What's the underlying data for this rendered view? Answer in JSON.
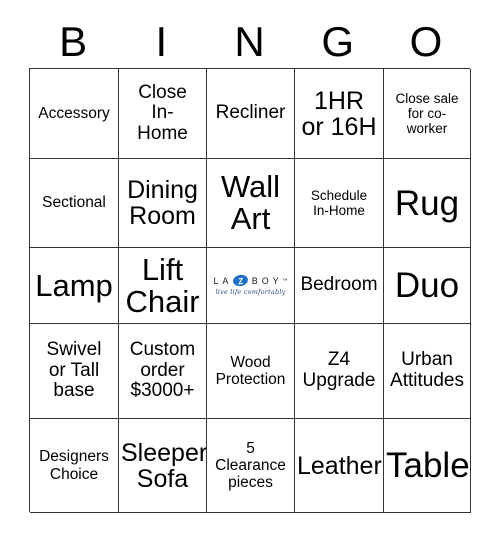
{
  "header": {
    "letters": [
      "B",
      "I",
      "N",
      "G",
      "O"
    ]
  },
  "grid": {
    "rows": [
      [
        {
          "label": "Accessory",
          "size": "sm"
        },
        {
          "label": "Close\nIn-\nHome",
          "size": "md"
        },
        {
          "label": "Recliner",
          "size": "md"
        },
        {
          "label": "1HR\nor 16H",
          "size": "lg"
        },
        {
          "label": "Close sale\nfor co-\nworker",
          "size": "xs"
        }
      ],
      [
        {
          "label": "Sectional",
          "size": "sm"
        },
        {
          "label": "Dining\nRoom",
          "size": "lg"
        },
        {
          "label": "Wall\nArt",
          "size": "xl"
        },
        {
          "label": "Schedule\nIn-Home",
          "size": "xs"
        },
        {
          "label": "Rug",
          "size": "xxl"
        }
      ],
      [
        {
          "label": "Lamp",
          "size": "xl"
        },
        {
          "label": "Lift\nChair",
          "size": "xl"
        },
        {
          "label": "",
          "size": "sm",
          "logo": true
        },
        {
          "label": "Bedroom",
          "size": "md"
        },
        {
          "label": "Duo",
          "size": "xxl"
        }
      ],
      [
        {
          "label": "Swivel\nor Tall\nbase",
          "size": "md"
        },
        {
          "label": "Custom\norder\n$3000+",
          "size": "md"
        },
        {
          "label": "Wood\nProtection",
          "size": "sm"
        },
        {
          "label": "Z4\nUpgrade",
          "size": "md"
        },
        {
          "label": "Urban\nAttitudes",
          "size": "md"
        }
      ],
      [
        {
          "label": "Designers\nChoice",
          "size": "sm"
        },
        {
          "label": "Sleeper\nSofa",
          "size": "lg"
        },
        {
          "label": "5\nClearance\npieces",
          "size": "sm"
        },
        {
          "label": "Leather",
          "size": "lg"
        },
        {
          "label": "Table",
          "size": "xxl"
        }
      ]
    ]
  },
  "free_space_logo": {
    "letters_before": [
      "L",
      "A"
    ],
    "z_letter": "Z",
    "letters_after": [
      "B",
      "O",
      "Y"
    ],
    "trademark": "™",
    "tagline": "live life comfortably",
    "accent_color": "#1f6fc4",
    "tagline_color": "#2a4a7a"
  },
  "colors": {
    "border": "#333333",
    "background": "#ffffff",
    "text": "#000000"
  }
}
